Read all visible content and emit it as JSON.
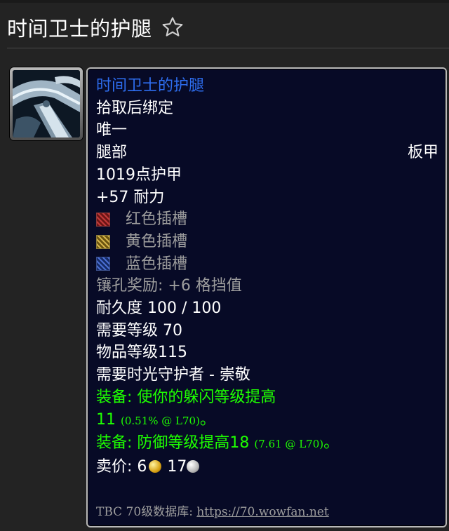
{
  "header": {
    "title": "时间卫士的护腿",
    "favorite_icon": "star-outline-icon"
  },
  "item_icon": "plate-leggings-icon",
  "tooltip": {
    "name": "时间卫士的护腿",
    "name_color": "#2e6ef0",
    "bind": "拾取后绑定",
    "unique": "唯一",
    "slot": "腿部",
    "armor_type": "板甲",
    "armor": "1019点护甲",
    "stat": "+57 耐力",
    "sockets": [
      {
        "icon": "red-socket-icon",
        "label": "红色插槽"
      },
      {
        "icon": "yellow-socket-icon",
        "label": "黄色插槽"
      },
      {
        "icon": "blue-socket-icon",
        "label": "蓝色插槽"
      }
    ],
    "socket_bonus": "镶孔奖励: +6 格挡值",
    "durability": "耐久度 100 / 100",
    "required_level": "需要等级 70",
    "item_level": "物品等级115",
    "required_reputation": "需要时光守护者 - 崇敬",
    "equip1_line1": "装备:  使你的躲闪等级提高",
    "equip1_value": "11",
    "equip1_detail": "(0.51% @ L70)",
    "equip1_end": "。",
    "equip2": "装备:  防御等级提高18",
    "equip2_detail": "(7.61 @ L70)",
    "equip2_end": "。",
    "sell_label": "卖价: ",
    "sell_gold": "6",
    "sell_silver": "17",
    "gold_icon": "gold-coin-icon",
    "silver_icon": "silver-coin-icon",
    "footer_label": "TBC 70级数据库: ",
    "footer_link": "https://70.wowfan.net"
  },
  "colors": {
    "background": "#232323",
    "tooltip_bg": "#070a26",
    "equip_green": "#1eff00",
    "grey_text": "#9d9d9d"
  }
}
